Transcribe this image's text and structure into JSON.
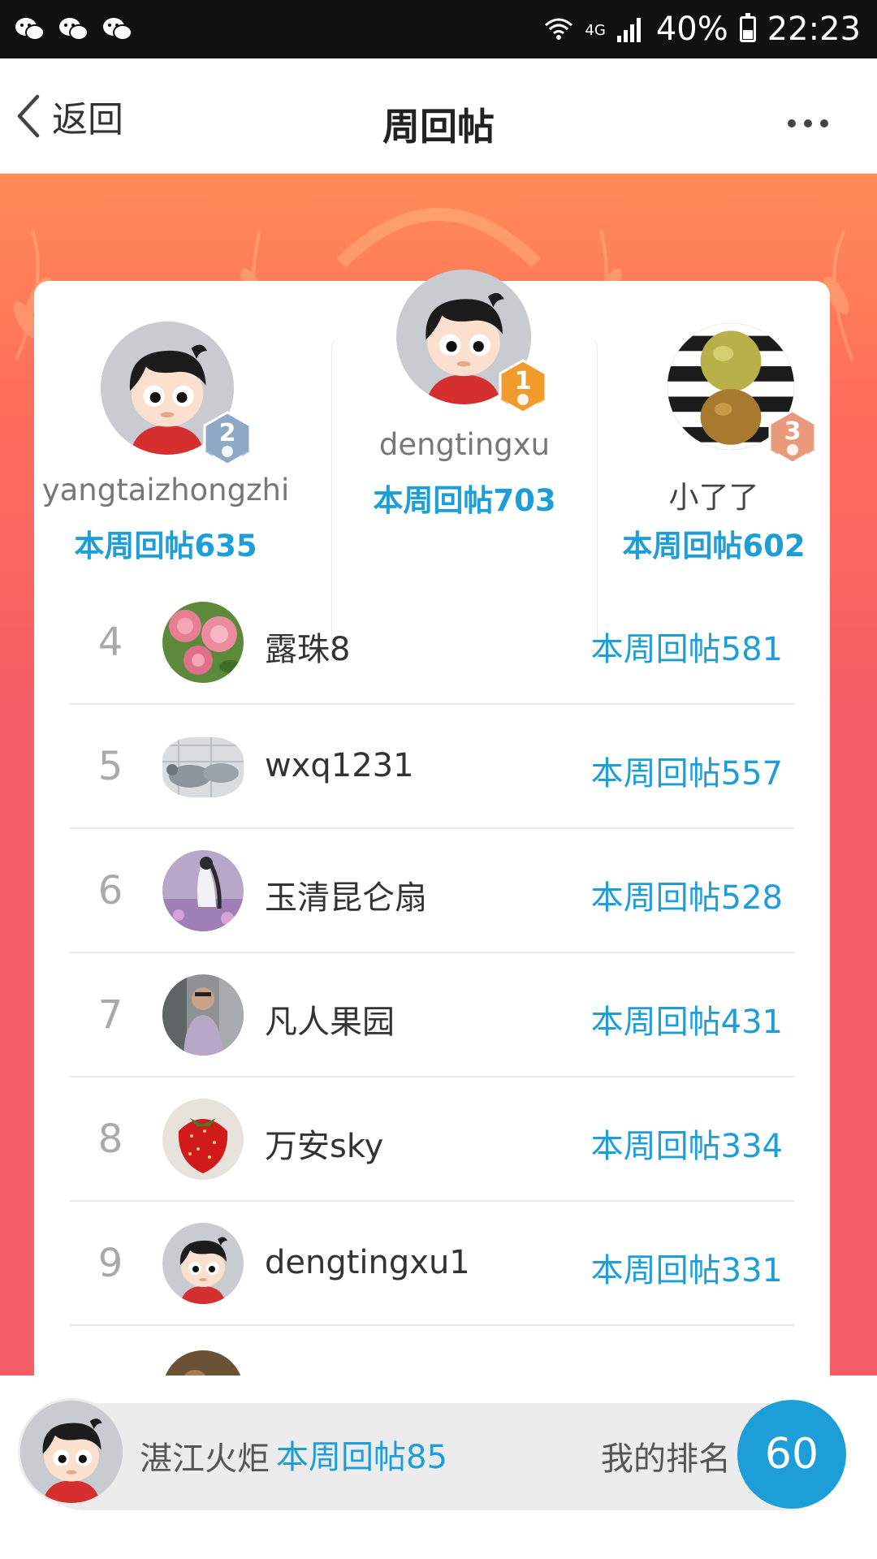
{
  "status_bar": {
    "network": "4G",
    "battery": "40%",
    "time": "22:23"
  },
  "nav": {
    "back_label": "返回",
    "title": "周回帖"
  },
  "podium": [
    {
      "rank": "2",
      "name": "yangtaizhongzhi",
      "score": "本周回帖635"
    },
    {
      "rank": "1",
      "name": "dengtingxu",
      "score": "本周回帖703"
    },
    {
      "rank": "3",
      "name": "小了了",
      "score": "本周回帖602"
    }
  ],
  "ranking": [
    {
      "rank": "4",
      "name": "露珠8",
      "score": "本周回帖581",
      "avatar": "roses"
    },
    {
      "rank": "5",
      "name": "wxq1231",
      "score": "本周回帖557",
      "avatar": "pigeons"
    },
    {
      "rank": "6",
      "name": "玉清昆仑扇",
      "score": "本周回帖528",
      "avatar": "flowers"
    },
    {
      "rank": "7",
      "name": "凡人果园",
      "score": "本周回帖431",
      "avatar": "man"
    },
    {
      "rank": "8",
      "name": "万安sky",
      "score": "本周回帖334",
      "avatar": "strawberry"
    },
    {
      "rank": "9",
      "name": "dengtingxu1",
      "score": "本周回帖331",
      "avatar": "cartoon-boy"
    }
  ],
  "me": {
    "name": "湛江火炬",
    "score": "本周回帖85",
    "rank_label": "我的排名",
    "rank": "60"
  },
  "colors": {
    "accent_blue": "#1e9ed9",
    "banner_top": "#ff8c57",
    "banner_bottom": "#f55e66",
    "gold_badge": "#f29b2d",
    "silver_badge": "#8fa8c6",
    "bronze_badge": "#e89a7a"
  }
}
